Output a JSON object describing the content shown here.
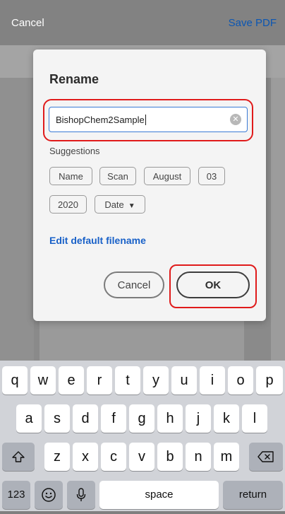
{
  "topbar": {
    "cancel_label": "Cancel",
    "save_label": "Save PDF"
  },
  "dialog": {
    "title": "Rename",
    "filename_value": "BishopChem2Sample",
    "suggestions_label": "Suggestions",
    "suggestions": [
      "Name",
      "Scan",
      "August",
      "03",
      "2020",
      "Date"
    ],
    "edit_default_label": "Edit default filename",
    "cancel_label": "Cancel",
    "ok_label": "OK",
    "highlight_color": "#e01b1b"
  },
  "keyboard": {
    "row1": [
      "q",
      "w",
      "e",
      "r",
      "t",
      "y",
      "u",
      "i",
      "o",
      "p"
    ],
    "row2": [
      "a",
      "s",
      "d",
      "f",
      "g",
      "h",
      "j",
      "k",
      "l"
    ],
    "row3": [
      "z",
      "x",
      "c",
      "v",
      "b",
      "n",
      "m"
    ],
    "shift_icon": "shift-icon",
    "backspace_icon": "backspace-icon",
    "numbers_label": "123",
    "emoji_icon": "emoji-icon",
    "mic_icon": "microphone-icon",
    "space_label": "space",
    "return_label": "return"
  }
}
